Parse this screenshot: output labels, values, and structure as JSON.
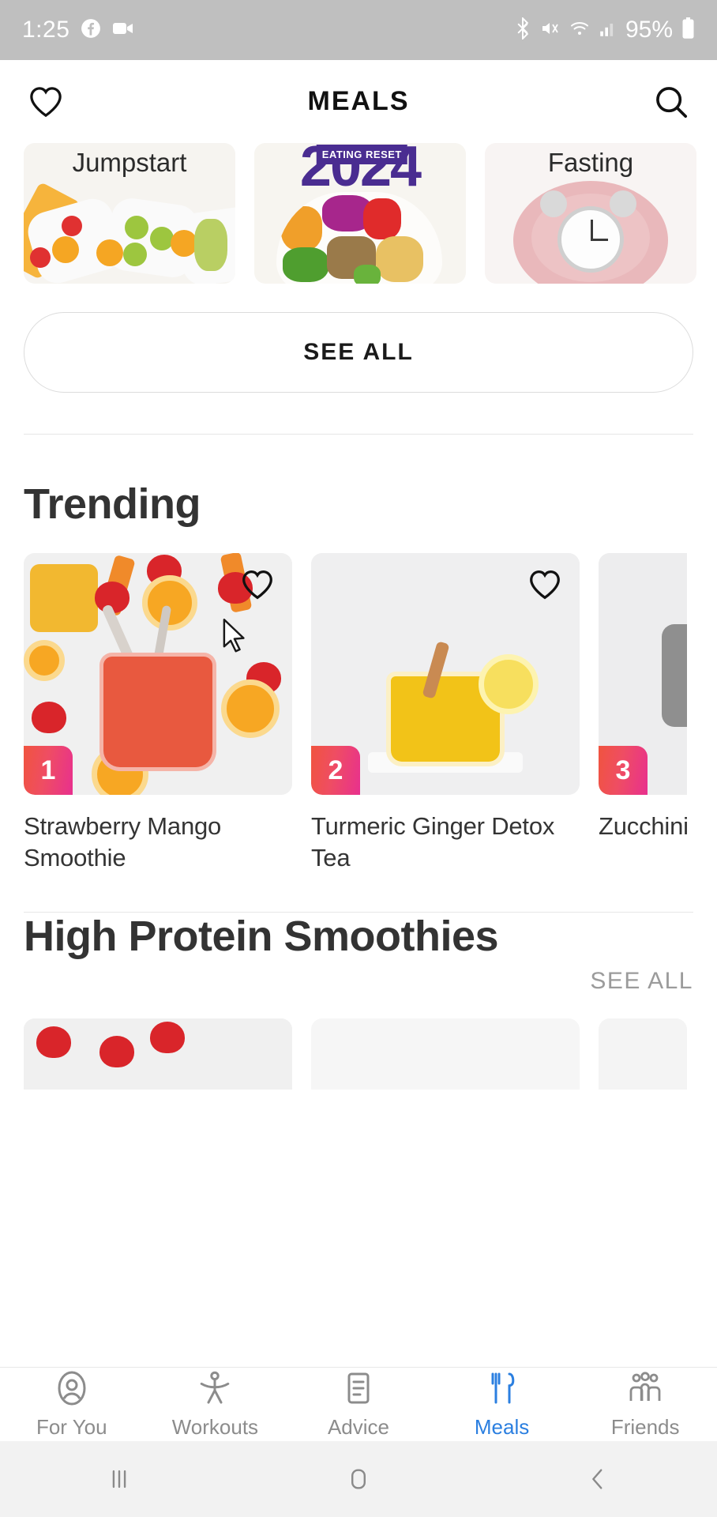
{
  "status_bar": {
    "time": "1:25",
    "battery_percent": "95%",
    "icons": [
      "facebook-icon",
      "video-camera-icon",
      "bluetooth-icon",
      "mute-icon",
      "wifi-icon",
      "cell-signal-icon",
      "battery-icon"
    ]
  },
  "app_bar": {
    "title": "MEALS",
    "left_icon": "heart-icon",
    "right_icon": "search-icon"
  },
  "programs": {
    "cards": [
      {
        "label": "Jumpstart",
        "badge": ""
      },
      {
        "label": "",
        "badge": "EATING RESET",
        "year": "2024"
      },
      {
        "label": "Fasting",
        "badge": ""
      }
    ],
    "see_all_label": "SEE ALL"
  },
  "trending": {
    "title": "Trending",
    "items": [
      {
        "rank": "1",
        "name": "Strawberry Mango Smoothie",
        "favorite_icon": "heart-icon"
      },
      {
        "rank": "2",
        "name": "Turmeric Ginger Detox Tea",
        "favorite_icon": "heart-icon"
      },
      {
        "rank": "3",
        "name": "Zucchini Lasagna",
        "favorite_icon": "heart-icon"
      }
    ]
  },
  "high_protein": {
    "title": "High Protein Smoothies",
    "see_all_label": "SEE ALL"
  },
  "bottom_nav": {
    "items": [
      {
        "label": "For You",
        "icon": "profile-icon",
        "active": false
      },
      {
        "label": "Workouts",
        "icon": "runner-icon",
        "active": false
      },
      {
        "label": "Advice",
        "icon": "document-icon",
        "active": false
      },
      {
        "label": "Meals",
        "icon": "cutlery-icon",
        "active": true
      },
      {
        "label": "Friends",
        "icon": "people-icon",
        "active": false
      }
    ],
    "active_color": "#2b7fe0"
  },
  "android_nav": {
    "recents": "recents-icon",
    "home": "home-icon",
    "back": "back-icon"
  },
  "colors": {
    "rank_badge_start": "#f0543f",
    "rank_badge_end": "#e8308e",
    "accent_blue": "#2b7fe0",
    "heading": "#333333"
  }
}
